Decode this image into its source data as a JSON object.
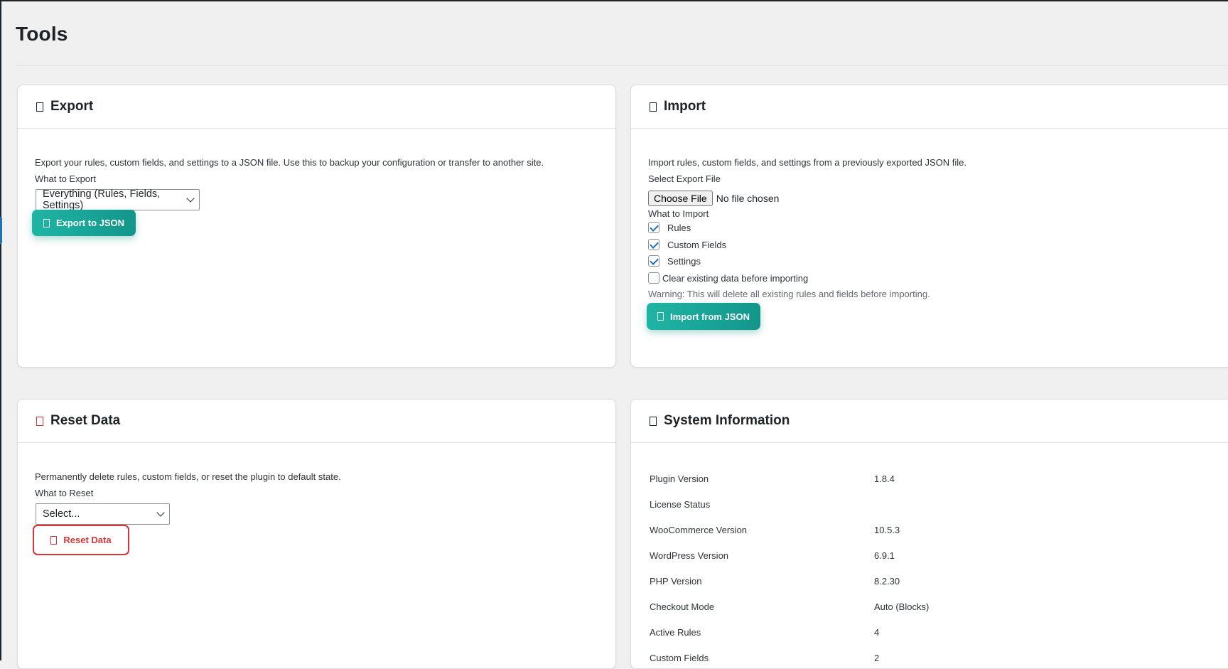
{
  "page": {
    "title": "Tools"
  },
  "export": {
    "title": "Export",
    "icon": "file-icon",
    "description": "Export your rules, custom fields, and settings to a JSON file. Use this to backup your configuration or transfer to another site.",
    "what_label": "What to Export",
    "selected": "Everything (Rules, Fields, Settings)",
    "button_label": "Export to JSON",
    "button_icon": "download-icon"
  },
  "import": {
    "title": "Import",
    "icon": "file-icon",
    "description": "Import rules, custom fields, and settings from a previously exported JSON file.",
    "file_label": "Select Export File",
    "choose_file_label": "Choose File",
    "file_status": "No file chosen",
    "what_label": "What to Import",
    "options": [
      {
        "label": "Rules",
        "checked": true
      },
      {
        "label": "Custom Fields",
        "checked": true
      },
      {
        "label": "Settings",
        "checked": true
      }
    ],
    "clear_label": "Clear existing data before importing",
    "clear_checked": false,
    "warning": "Warning: This will delete all existing rules and fields before importing.",
    "button_label": "Import from JSON",
    "button_icon": "upload-icon"
  },
  "reset": {
    "title": "Reset Data",
    "icon": "trash-icon",
    "danger_color": "#d63638",
    "description": "Permanently delete rules, custom fields, or reset the plugin to default state.",
    "what_label": "What to Reset",
    "selected": "Select...",
    "button_label": "Reset Data",
    "button_icon": "trash-icon"
  },
  "system_info": {
    "title": "System Information",
    "icon": "info-icon",
    "rows": [
      {
        "key": "Plugin Version",
        "value": "1.8.4"
      },
      {
        "key": "License Status",
        "value": ""
      },
      {
        "key": "WooCommerce Version",
        "value": "10.5.3"
      },
      {
        "key": "WordPress Version",
        "value": "6.9.1"
      },
      {
        "key": "PHP Version",
        "value": "8.2.30"
      },
      {
        "key": "Checkout Mode",
        "value": "Auto (Blocks)"
      },
      {
        "key": "Active Rules",
        "value": "4"
      },
      {
        "key": "Custom Fields",
        "value": "2"
      }
    ]
  },
  "colors": {
    "accent": "#1fb5a5",
    "accent_dark": "#13968a",
    "danger": "#d63638",
    "background": "#f0f0f1",
    "checkbox": "#2271b1"
  }
}
